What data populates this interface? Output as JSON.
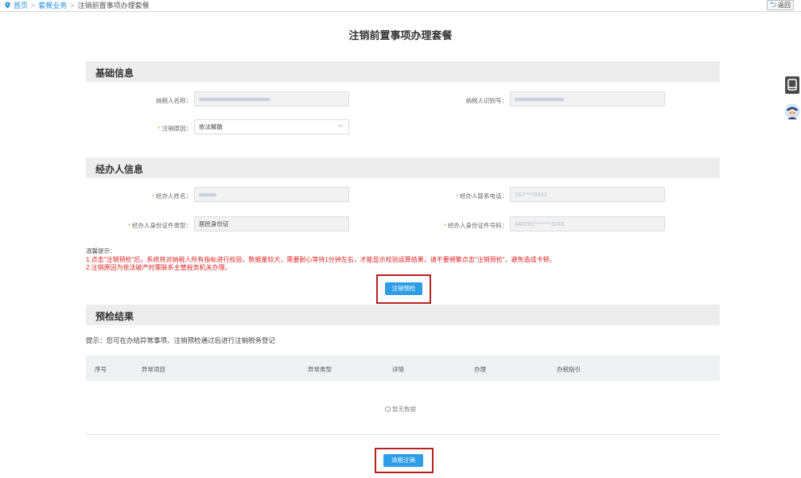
{
  "breadcrumb": {
    "home": "首页",
    "separator1": ">",
    "package_business": "套餐业务",
    "separator2": ">",
    "current": "注销前置事项办理套餐"
  },
  "back_button": "返回",
  "page_title": "注销前置事项办理套餐",
  "basic_info": {
    "title": "基础信息",
    "taxpayer_name_label": "纳税人名称：",
    "taxpayer_id_label": "纳税人识别号：",
    "cancel_reason_label": "注销原因：",
    "cancel_reason_value": "依法解散"
  },
  "agent_info": {
    "title": "经办人信息",
    "name_label": "经办人姓名：",
    "phone_label": "经办人联系电话：",
    "phone_value": "157****8891",
    "id_type_label": "经办人身份证件类型：",
    "id_type_value": "居民身份证",
    "id_number_label": "经办人身份证件号码：",
    "id_number_value": "440281*******3246"
  },
  "tips": {
    "title": "温馨提示：",
    "line1": "1.点击\"注销预检\"后，系统将对纳税人所有指标进行校验，数据量较大，需要耐心等待1分钟左右，才能显示校验运算结果，请不要频繁点击\"注销预检\"，避免造成卡顿。",
    "line2": "2.注销原因为依法破产时需联系主管税务机关办理。"
  },
  "precheck_button": "注销预检",
  "result": {
    "title": "预检结果",
    "hint": "提示：您可在办结异常事项、注销预检通过后进行注销税务登记",
    "columns": [
      "序号",
      "异常项目",
      "异常类型",
      "详情",
      "办理",
      "办税指引"
    ],
    "no_data": "暂无数据"
  },
  "clear_cancel_button": "清税注销",
  "colors": {
    "primary": "#2d9de8",
    "link": "#1e8fe1",
    "warning_text": "#e32222",
    "highlight_border": "#b92020",
    "required_star": "#f08a24",
    "section_bg": "#ededed"
  }
}
